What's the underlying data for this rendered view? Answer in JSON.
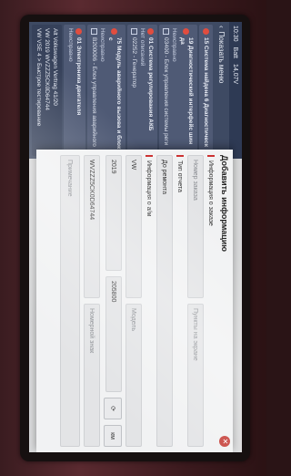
{
  "status": {
    "time": "10:30",
    "battery": "Batt",
    "voltage": "14,07V"
  },
  "nav": {
    "back_label": "Показать меню"
  },
  "groups": [
    {
      "title": "15 Система найдена 6 Диагностическ",
      "sub": "",
      "items": []
    },
    {
      "title": "19 Диагностический интерфейс шин да",
      "sub": "Неисправно",
      "items": [
        "03400 - Блок управления системы реги"
      ]
    },
    {
      "title": "01 Система регулирования АКБ",
      "sub": "Нет описаний",
      "items": [
        "02252 - Генератор"
      ]
    },
    {
      "title": "75 Модуль аварийного вызова и блок с",
      "sub": "Неисправно",
      "items": [
        "B200006 - Блок управления аварийного"
      ]
    },
    {
      "title": "01 Электроника двигателя",
      "sub": "Неисправно",
      "items": []
    }
  ],
  "footer": {
    "line1": "Alt Volkswagen Vertrag 41/20",
    "line2": "VW 2019 WVZZZ5CK0D64744",
    "line3": "VW VSE 4 > Быстрое тестирование"
  },
  "dialog": {
    "title": "Добавить информацию",
    "order_section": "Информация о заказе",
    "order_placeholder": "Номер заказа",
    "pages_placeholder": "Пункты на экране",
    "report_section": "Тип отчета",
    "report_value": "До ремонта",
    "vehicle_section": "Информация о а/м",
    "make": "VW",
    "model_placeholder": "Модель",
    "year": "2019",
    "mileage": "205800",
    "unit": "км",
    "vin": "WVZZZ5CK0D64744",
    "plate_placeholder": "Номерной знак",
    "notes_placeholder": "Примечание"
  }
}
